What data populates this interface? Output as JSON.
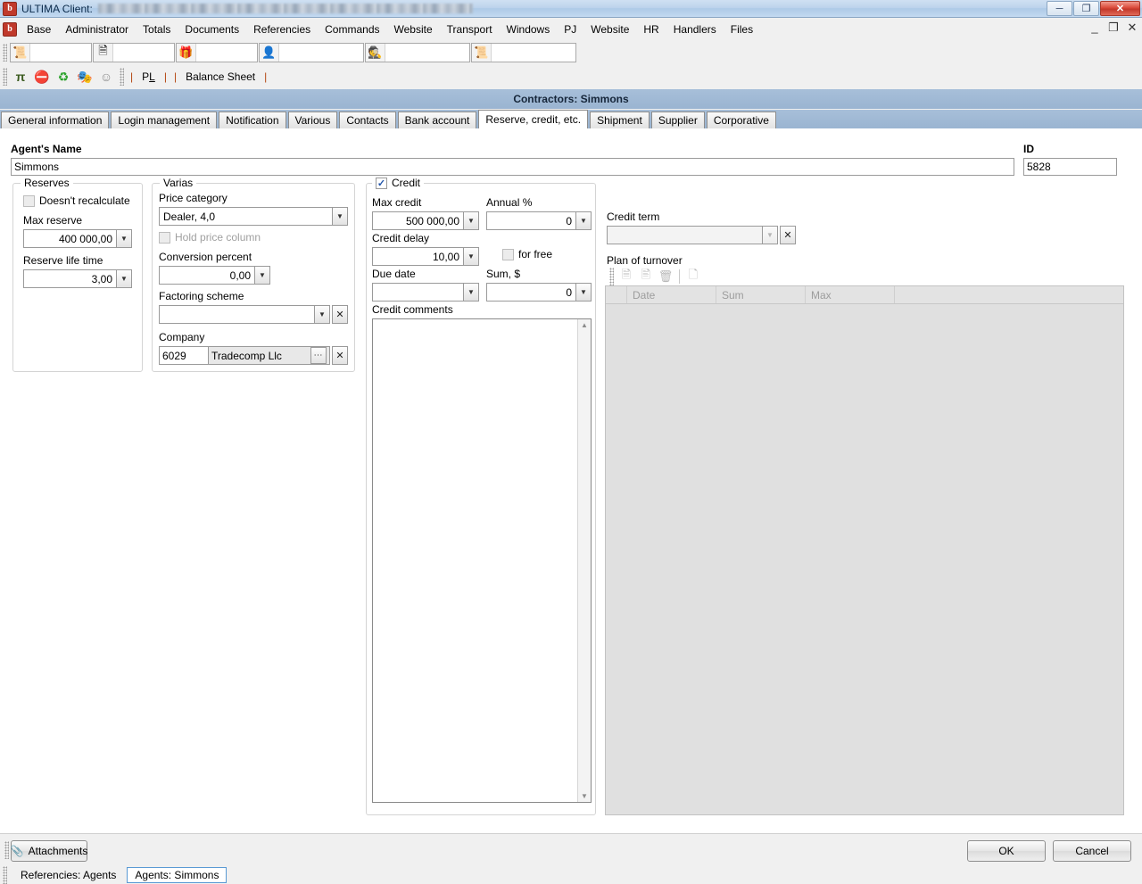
{
  "window": {
    "app_icon": "ultima-logo-icon",
    "title": "ULTIMA Client:",
    "title_redacted": "████████ ██████ ████████ █████",
    "minimize": "–",
    "maximize": "❐",
    "close": "✕"
  },
  "menubar": {
    "items": [
      "Base",
      "Administrator",
      "Totals",
      "Documents",
      "Referencies",
      "Commands",
      "Website",
      "Transport",
      "Windows",
      "PJ",
      "Website",
      "HR",
      "Handlers",
      "Files"
    ],
    "mdi_minimize": "–",
    "mdi_restore": "❐",
    "mdi_close": "✕"
  },
  "toolbar1": {
    "combos": [
      {
        "icon": "document-number-icon",
        "glyph": "🗎",
        "value": ""
      },
      {
        "icon": "document-list-icon",
        "glyph": "🗒",
        "value": ""
      },
      {
        "icon": "gift-box-icon",
        "glyph": "🎁",
        "value": ""
      },
      {
        "icon": "person-portrait-icon",
        "glyph": "👤",
        "value": ""
      },
      {
        "icon": "detective-hat-icon",
        "glyph": "🕵",
        "value": ""
      },
      {
        "icon": "scroll-document-icon",
        "glyph": "📜",
        "value": ""
      }
    ]
  },
  "toolbar2": {
    "icons": [
      {
        "name": "pi-formula-icon",
        "glyph": "π"
      },
      {
        "name": "forbidden-icon",
        "glyph": "⛔"
      },
      {
        "name": "refresh-recycle-icon",
        "glyph": "↻"
      },
      {
        "name": "theater-masks-icon",
        "glyph": "🎭"
      },
      {
        "name": "ghost-icon",
        "glyph": "☺"
      }
    ],
    "sep1": "|",
    "link_pl": "PL",
    "sep2": "|",
    "sep3": "|",
    "link_balance": "Balance Sheet",
    "sep4": "|"
  },
  "mdi": {
    "caption": "Contractors: Simmons",
    "tabs": [
      {
        "label": "General information",
        "active": false
      },
      {
        "label": "Login management",
        "active": false
      },
      {
        "label": "Notification",
        "active": false
      },
      {
        "label": "Various",
        "active": false
      },
      {
        "label": "Contacts",
        "active": false
      },
      {
        "label": "Bank account",
        "active": false
      },
      {
        "label": "Reserve, credit, etc.",
        "active": true
      },
      {
        "label": "Shipment",
        "active": false
      },
      {
        "label": "Supplier",
        "active": false
      },
      {
        "label": "Corporative",
        "active": false
      }
    ]
  },
  "form": {
    "agent_name_label": "Agent's Name",
    "agent_name_value": "Simmons",
    "id_label": "ID",
    "id_value": "5828",
    "reserves": {
      "title": "Reserves",
      "doesnt_recalculate_label": "Doesn't recalculate",
      "doesnt_recalculate_checked": false,
      "max_reserve_label": "Max reserve",
      "max_reserve_value": "400 000,00",
      "reserve_life_time_label": "Reserve life time",
      "reserve_life_time_value": "3,00"
    },
    "varias": {
      "title": "Varias",
      "price_category_label": "Price category",
      "price_category_value": "Dealer, 4,0",
      "hold_price_column_label": "Hold price column",
      "hold_price_column_checked": false,
      "conversion_percent_label": "Conversion percent",
      "conversion_percent_value": "0,00",
      "factoring_scheme_label": "Factoring scheme",
      "factoring_scheme_value": "",
      "company_label": "Company",
      "company_code": "6029",
      "company_name": "Tradecomp Llc",
      "dots_label": "…",
      "clear_label": "✕"
    },
    "credit": {
      "title": "Credit",
      "enabled": true,
      "max_credit_label": "Max credit",
      "max_credit_value": "500 000,00",
      "annual_percent_label": "Annual %",
      "annual_percent_value": "0",
      "credit_delay_label": "Credit delay",
      "credit_delay_value": "10,00",
      "for_free_label": "for free",
      "for_free_checked": false,
      "due_date_label": "Due date",
      "due_date_value": "",
      "sum_label": "Sum, $",
      "sum_value": "0",
      "credit_comments_label": "Credit comments",
      "credit_comments_value": ""
    },
    "credit_term": {
      "label": "Credit term",
      "value": "",
      "clear_label": "✕"
    },
    "plan_of_turnover": {
      "label": "Plan of turnover",
      "toolbar": [
        {
          "name": "new-record-icon",
          "glyph": "🗎"
        },
        {
          "name": "edit-record-icon",
          "glyph": "🗊"
        },
        {
          "name": "delete-record-icon",
          "glyph": "🗑"
        },
        {
          "name": "copy-record-icon",
          "glyph": "🗐"
        }
      ],
      "columns": [
        "Date",
        "Sum",
        "Max"
      ],
      "rows": []
    }
  },
  "footer": {
    "attachments_label": "Attachments",
    "attachments_icon": "paperclip-icon",
    "ok_label": "OK",
    "cancel_label": "Cancel"
  },
  "statusbar": {
    "tabs": [
      {
        "label": "Referencies: Agents",
        "active": false
      },
      {
        "label": "Agents: Simmons",
        "active": true
      }
    ]
  },
  "colors": {
    "mdi_caption": "#a7bfd9",
    "accent_link": "#b4440e",
    "grid_bg": "#e0e0e0",
    "close_btn": "#c3382b"
  }
}
